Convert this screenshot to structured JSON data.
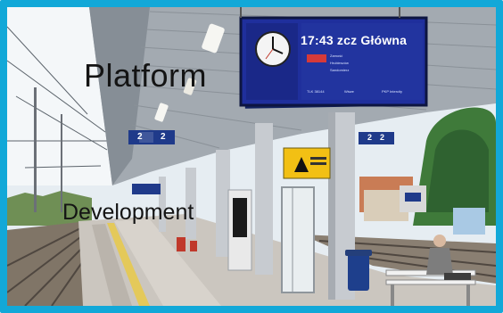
{
  "overlay": {
    "title_word_1": "Platform",
    "title_word_2": "Development"
  },
  "departure_board": {
    "time": "17:43",
    "destination": "zcz Główna",
    "via": [
      "Zamość",
      "Hrubieszów",
      "Sandomierz"
    ],
    "footer_labels": [
      "TLK 38144",
      "Wśwe",
      "PKP Intercity"
    ]
  },
  "platform_signs": [
    {
      "platform": "2",
      "track": "2"
    },
    {
      "platform": "2",
      "track": "2"
    }
  ],
  "colors": {
    "frame_border": "#12a8d8",
    "board_blue": "#1f2f9c",
    "sign_blue": "#1f3a8a",
    "roof": "#9aa2aa",
    "pillar": "#c9cdd2",
    "platform_floor": "#cfcac4",
    "yellow_line": "#e6c94b",
    "tree_green": "#3f7a3a",
    "bin_blue": "#1e3f8c",
    "bench_white": "#f2f2f2",
    "warning_yellow": "#f2c014"
  }
}
